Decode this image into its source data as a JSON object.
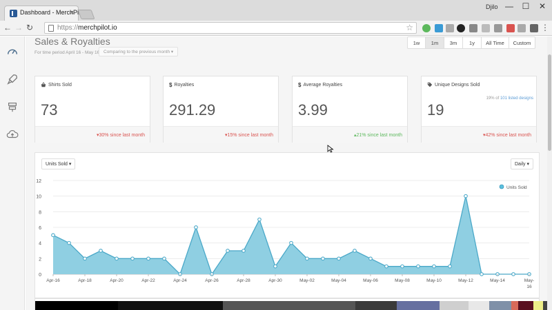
{
  "browser": {
    "tab_title": "Dashboard - MerchPilot",
    "tab_close": "×",
    "profile": "Djilo",
    "url_scheme": "https://",
    "url_host": "merchpilot.io",
    "win_min": "—",
    "win_max": "☐",
    "win_close": "✕"
  },
  "header": {
    "title": "Sales & Royalties",
    "period": "For time period April 16 - May 16",
    "compare": "Comparing to the previous month ▾",
    "ranges": [
      {
        "label": "1w",
        "active": false
      },
      {
        "label": "1m",
        "active": true
      },
      {
        "label": "3m",
        "active": false
      },
      {
        "label": "1y",
        "active": false
      },
      {
        "label": "All Time",
        "active": false
      },
      {
        "label": "Custom",
        "active": false
      }
    ]
  },
  "cards": [
    {
      "label": "Shirts Sold",
      "value": "73",
      "extra": "",
      "change": "▾30% since last month",
      "direction": "down"
    },
    {
      "label": "Royalties",
      "value": "291.29",
      "extra": "",
      "change": "▾15% since last month",
      "direction": "down"
    },
    {
      "label": "Average Royalties",
      "value": "3.99",
      "extra": "",
      "change": "▴21% since last month",
      "direction": "up"
    },
    {
      "label": "Unique Designs Sold",
      "value": "19",
      "extra_pre": "19% of ",
      "extra_link": "101 listed designs",
      "change": "▾42% since last month",
      "direction": "down"
    }
  ],
  "chart_panel": {
    "metric_select": "Units Sold ▾",
    "interval_select": "Daily ▾"
  },
  "colors": {
    "accent": "#5bc0de",
    "area_fill": "#8fcfe2",
    "line": "#4aa8c8",
    "down": "#d9534f",
    "up": "#5cb85c"
  },
  "chart_data": {
    "type": "area",
    "title": "",
    "xlabel": "",
    "ylabel": "",
    "ylim": [
      0,
      12
    ],
    "yticks": [
      0,
      2,
      4,
      6,
      8,
      10,
      12
    ],
    "grid": true,
    "legend": "top-right",
    "x": [
      "Apr-16",
      "Apr-17",
      "Apr-18",
      "Apr-19",
      "Apr-20",
      "Apr-21",
      "Apr-22",
      "Apr-23",
      "Apr-24",
      "Apr-25",
      "Apr-26",
      "Apr-27",
      "Apr-28",
      "Apr-29",
      "Apr-30",
      "May-01",
      "May-02",
      "May-03",
      "May-04",
      "May-05",
      "May-06",
      "May-07",
      "May-08",
      "May-09",
      "May-10",
      "May-11",
      "May-12",
      "May-13",
      "May-14",
      "May-15",
      "May-16"
    ],
    "xtick_labels": [
      "Apr-16",
      "Apr-18",
      "Apr-20",
      "Apr-22",
      "Apr-24",
      "Apr-26",
      "Apr-28",
      "Apr-30",
      "May-02",
      "May-04",
      "May-06",
      "May-08",
      "May-10",
      "May-12",
      "May-14",
      "May-16"
    ],
    "series": [
      {
        "name": "Units Sold",
        "values": [
          5,
          4,
          2,
          3,
          2,
          2,
          2,
          2,
          0,
          6,
          0,
          3,
          3,
          7,
          1,
          4,
          2,
          2,
          2,
          3,
          2,
          1,
          1,
          1,
          1,
          1,
          10,
          0,
          0,
          0,
          0
        ]
      }
    ]
  },
  "strip_colors": [
    "#000000",
    "#101010",
    "#555555",
    "#3a3a3a",
    "#6670a0",
    "#cfcfcf",
    "#e8e8e8",
    "#7f90a8",
    "#d96a5a",
    "#5a1020",
    "#eeee88",
    "#444444"
  ],
  "icons": {
    "sidebar": [
      "dashboard-gauge-icon",
      "rocket-icon",
      "signpost-icon",
      "cloud-upload-icon"
    ]
  }
}
